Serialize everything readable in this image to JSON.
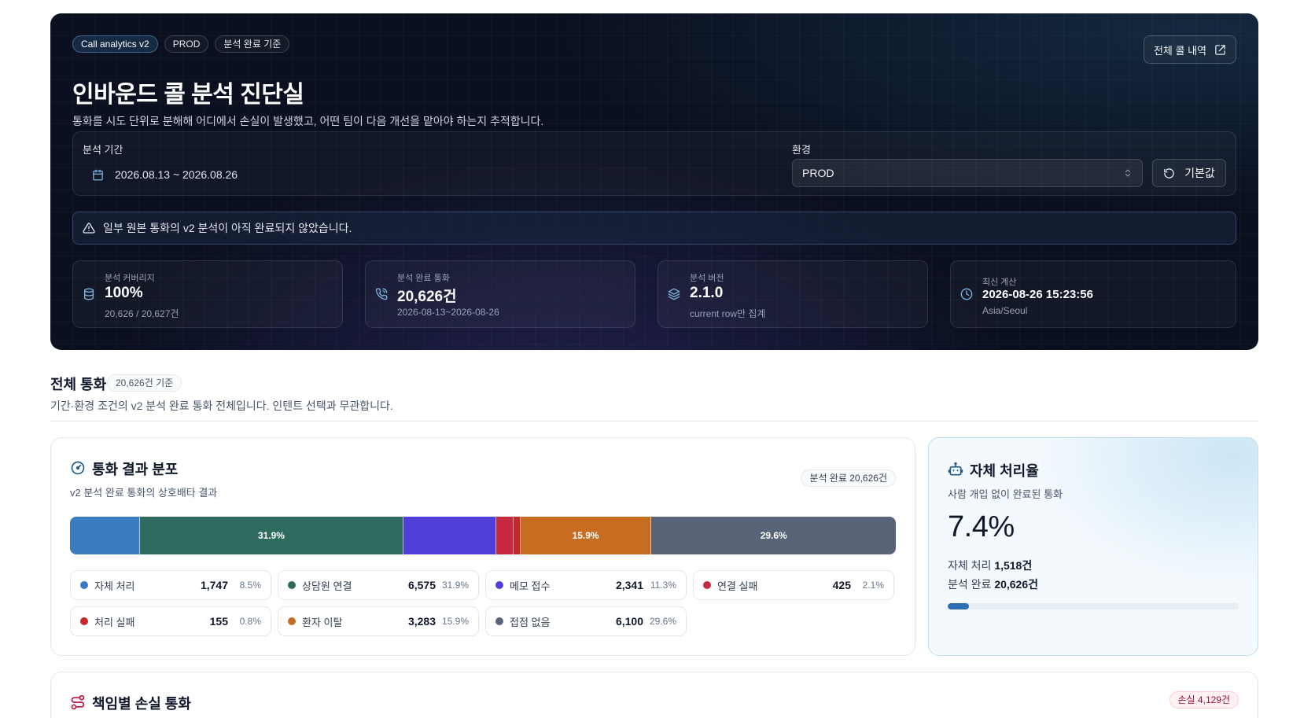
{
  "hero": {
    "chips": [
      "Call analytics v2",
      "PROD",
      "분석 완료 기준"
    ],
    "title": "인바운드 콜 분석 진단실",
    "subtitle": "통화를 시도 단위로 분해해 어디에서 손실이 발생했고, 어떤 팀이 다음 개선을 맡아야 하는지 추적합니다.",
    "all_calls_button": "전체 콜 내역"
  },
  "filters": {
    "period_label": "분석 기간",
    "period_value": "2026.08.13 ~ 2026.08.26",
    "env_label": "환경",
    "env_value": "PROD",
    "reset_label": "기본값"
  },
  "alert": {
    "text": "일부 원본 통화의 v2 분석이 아직 완료되지 않았습니다."
  },
  "stats": [
    {
      "label": "분석 커버리지",
      "value": "100%",
      "sub": "20,626 / 20,627건",
      "icon": "database-icon"
    },
    {
      "label": "분석 완료 통화",
      "value": "20,626건",
      "sub": "2026-08-13~2026-08-26",
      "icon": "phone-icon"
    },
    {
      "label": "분석 버전",
      "value": "2.1.0",
      "sub": "current row만 집계",
      "icon": "layers-icon"
    },
    {
      "label": "최신 계산",
      "value": "2026-08-26 15:23:56",
      "sub": "Asia/Seoul",
      "icon": "clock-icon"
    }
  ],
  "section": {
    "title": "전체 통화",
    "badge": "20,626건 기준",
    "description": "기간·환경 조건의 v2 분석 완료 통화 전체입니다. 인텐트 선택과 무관합니다."
  },
  "distribution": {
    "title": "통화 결과 분포",
    "subtitle": "v2 분석 완료 통화의 상호배타 결과",
    "badge": "분석 완료 20,626건",
    "segments": [
      {
        "name": "자체 처리",
        "count": "1,747",
        "pct": "8.5%",
        "share": 8.5,
        "color": "#3b7bbf",
        "bar_label": ""
      },
      {
        "name": "상담원 연결",
        "count": "6,575",
        "pct": "31.9%",
        "share": 31.9,
        "color": "#2e6b5e",
        "bar_label": "31.9%"
      },
      {
        "name": "메모 접수",
        "count": "2,341",
        "pct": "11.3%",
        "share": 11.3,
        "color": "#4f3fd8",
        "bar_label": ""
      },
      {
        "name": "연결 실패",
        "count": "425",
        "pct": "2.1%",
        "share": 2.1,
        "color": "#c8283f",
        "bar_label": ""
      },
      {
        "name": "처리 실패",
        "count": "155",
        "pct": "0.8%",
        "share": 0.8,
        "color": "#c62828",
        "bar_label": ""
      },
      {
        "name": "환자 이탈",
        "count": "3,283",
        "pct": "15.9%",
        "share": 15.9,
        "color": "#c76d22",
        "bar_label": "15.9%"
      },
      {
        "name": "접점 없음",
        "count": "6,100",
        "pct": "29.6%",
        "share": 29.6,
        "color": "#5a6478",
        "bar_label": "29.6%"
      }
    ]
  },
  "self_rate": {
    "title": "자체 처리율",
    "subtitle": "사람 개입 없이 완료된 통화",
    "value": "7.4%",
    "fraction": 0.074,
    "self_label": "자체 처리",
    "self_value": "1,518건",
    "done_label": "분석 완료",
    "done_value": "20,626건"
  },
  "loss": {
    "title": "책임별 손실 통화",
    "badge": "손실 4,129건"
  }
}
